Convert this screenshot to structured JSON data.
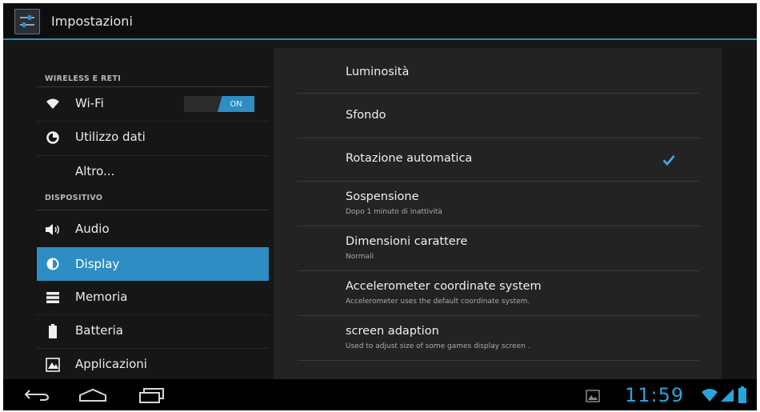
{
  "app": {
    "title": "Impostazioni"
  },
  "sidebar": {
    "sections": [
      {
        "header": "WIRELESS E RETI"
      },
      {
        "header": "DISPOSITIVO"
      }
    ],
    "items": [
      {
        "label": "Wi-Fi",
        "icon": "wifi-icon",
        "toggle": "ON"
      },
      {
        "label": "Utilizzo dati",
        "icon": "data-usage-icon"
      },
      {
        "label": "Altro..."
      },
      {
        "label": "Audio",
        "icon": "volume-icon"
      },
      {
        "label": "Display",
        "icon": "brightness-icon",
        "selected": true
      },
      {
        "label": "Memoria",
        "icon": "storage-icon"
      },
      {
        "label": "Batteria",
        "icon": "battery-icon"
      },
      {
        "label": "Applicazioni",
        "icon": "apps-icon"
      }
    ]
  },
  "display_settings": [
    {
      "title": "Luminosità"
    },
    {
      "title": "Sfondo"
    },
    {
      "title": "Rotazione automatica",
      "checked": true
    },
    {
      "title": "Sospensione",
      "summary": "Dopo 1 minuto di inattività"
    },
    {
      "title": "Dimensioni carattere",
      "summary": "Normali"
    },
    {
      "title": "Accelerometer coordinate system",
      "summary": "Accelerometer uses the default coordinate system."
    },
    {
      "title": "screen adaption",
      "summary": "Used to adjust size of some games display screen ."
    }
  ],
  "status_bar": {
    "time": "11:59"
  },
  "colors": {
    "accent": "#2e8dc2",
    "background": "#161616",
    "panel": "#232323"
  }
}
